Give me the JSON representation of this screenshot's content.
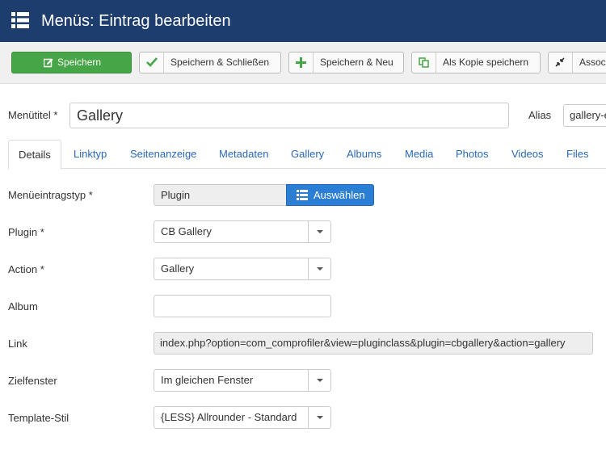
{
  "header": {
    "title": "Menüs: Eintrag bearbeiten"
  },
  "toolbar": {
    "save": "Speichern",
    "save_close": "Speichern & Schließen",
    "save_new": "Speichern & Neu",
    "save_copy": "Als Kopie speichern",
    "associations": "Assoc"
  },
  "form": {
    "title_label": "Menütitel *",
    "title_value": "Gallery",
    "alias_label": "Alias",
    "alias_value": "gallery-e"
  },
  "tabs": [
    "Details",
    "Linktyp",
    "Seitenanzeige",
    "Metadaten",
    "Gallery",
    "Albums",
    "Media",
    "Photos",
    "Videos",
    "Files"
  ],
  "fields": {
    "type_label": "Menüeintragstyp *",
    "type_value": "Plugin",
    "type_button": "Auswählen",
    "plugin_label": "Plugin *",
    "plugin_value": "CB Gallery",
    "action_label": "Action *",
    "action_value": "Gallery",
    "album_label": "Album",
    "album_value": "",
    "link_label": "Link",
    "link_value": "index.php?option=com_comprofiler&view=pluginclass&plugin=cbgallery&action=gallery",
    "target_label": "Zielfenster",
    "target_value": "Im gleichen Fenster",
    "template_label": "Template-Stil",
    "template_value": "{LESS} Allrounder - Standard"
  },
  "colors": {
    "header_bg": "#1c3d6e",
    "save_green": "#46a546",
    "link_blue": "#2a69b8",
    "button_blue": "#2a7ed3"
  }
}
